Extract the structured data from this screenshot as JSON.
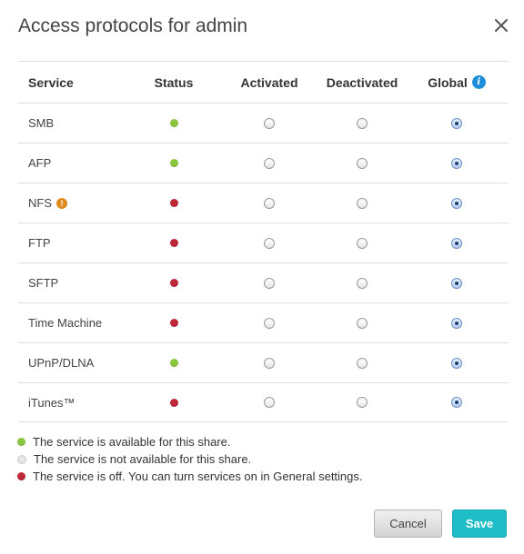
{
  "dialog": {
    "title": "Access protocols for admin"
  },
  "table": {
    "headers": {
      "service": "Service",
      "status": "Status",
      "activated": "Activated",
      "deactivated": "Deactivated",
      "global": "Global"
    },
    "rows": [
      {
        "service": "SMB",
        "status": "green",
        "selected": "global"
      },
      {
        "service": "AFP",
        "status": "green",
        "selected": "global"
      },
      {
        "service": "NFS",
        "status": "red",
        "selected": "global",
        "warning": "!"
      },
      {
        "service": "FTP",
        "status": "red",
        "selected": "global"
      },
      {
        "service": "SFTP",
        "status": "red",
        "selected": "global"
      },
      {
        "service": "Time Machine",
        "status": "red",
        "selected": "global"
      },
      {
        "service": "UPnP/DLNA",
        "status": "green",
        "selected": "global"
      },
      {
        "service": "iTunes™",
        "status": "red",
        "selected": "global"
      }
    ]
  },
  "legend": [
    {
      "color": "green",
      "text": "The service is available for this share."
    },
    {
      "color": "grey",
      "text": "The service is not available for this share."
    },
    {
      "color": "red",
      "text": "The service is off. You can turn services on in General settings."
    }
  ],
  "buttons": {
    "cancel": "Cancel",
    "save": "Save"
  },
  "icons": {
    "info": "i",
    "warning": "!"
  },
  "colors": {
    "green": "#8cc63f",
    "red": "#c0283a",
    "accent": "#1fbdc7",
    "info": "#1d8fd8",
    "warning": "#e08a1e"
  }
}
